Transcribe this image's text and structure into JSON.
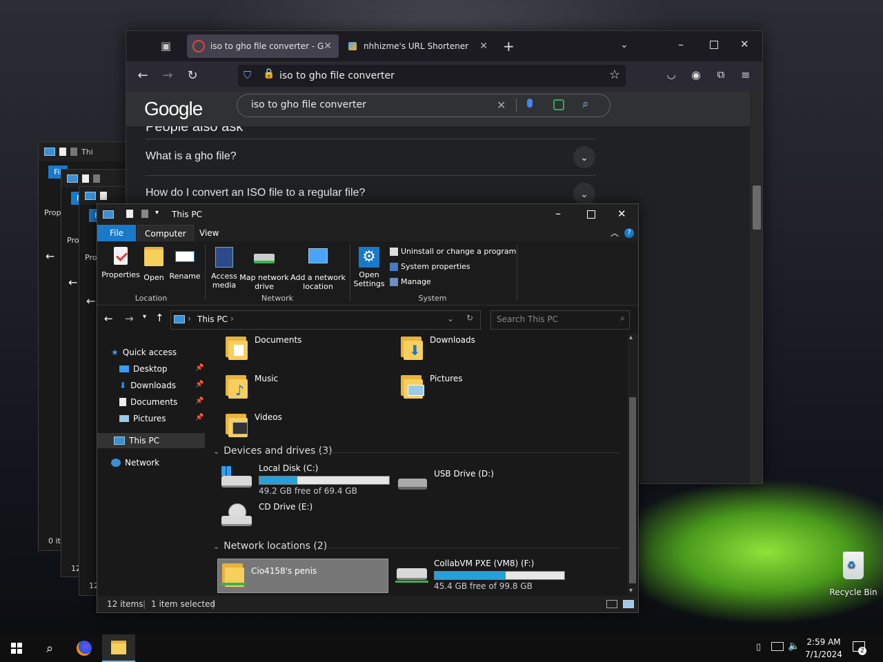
{
  "browser": {
    "tabs": [
      {
        "title": "iso to gho file converter - Goog",
        "active": true
      },
      {
        "title": "nhhizme's URL Shortener",
        "active": false
      }
    ],
    "url": "iso to gho file converter",
    "google_logo": "Google",
    "search_query": "iso to gho file converter",
    "paa_heading_partial": "People also ask",
    "paa_items": [
      "What is a gho file?",
      "How do I convert an ISO file to a regular file?"
    ]
  },
  "ghost_windows": {
    "title_partial": "Thi",
    "file_partial": "Fil",
    "props_partial_1": "Prop",
    "props_partial_2": "Pro",
    "status_partial_1": "0 it",
    "status_partial_2": "12",
    "status_partial_3": "12"
  },
  "explorer": {
    "title": "This PC",
    "tabs": [
      "File",
      "Computer",
      "View"
    ],
    "ribbon": {
      "location": {
        "group": "Location",
        "buttons": [
          "Properties",
          "Open",
          "Rename"
        ]
      },
      "network": {
        "group": "Network",
        "buttons": [
          "Access media",
          "Map network drive",
          "Add a network location"
        ]
      },
      "system": {
        "group": "System",
        "open_settings": "Open Settings",
        "items": [
          "Uninstall or change a program",
          "System properties",
          "Manage"
        ]
      }
    },
    "breadcrumb": "This PC",
    "search_placeholder": "Search This PC",
    "nav": {
      "quick_access": "Quick access",
      "pinned": [
        "Desktop",
        "Downloads",
        "Documents",
        "Pictures"
      ],
      "this_pc": "This PC",
      "network": "Network"
    },
    "folders": [
      "Documents",
      "Downloads",
      "Music",
      "Pictures",
      "Videos"
    ],
    "devices_header": "Devices and drives (3)",
    "drives": [
      {
        "name": "Local Disk (C:)",
        "free": "49.2 GB free of 69.4 GB",
        "used_fraction": 0.29
      },
      {
        "name": "USB Drive (D:)"
      },
      {
        "name": "CD Drive (E:)"
      }
    ],
    "network_header": "Network locations (2)",
    "network_locations": [
      {
        "name": "Cio4158's penis",
        "selected": true
      },
      {
        "name": "CollabVM PXE (VM8) (F:)",
        "free": "45.4 GB free of 99.8 GB",
        "used_fraction": 0.55
      }
    ],
    "status": {
      "items": "12 items",
      "selected": "1 item selected"
    }
  },
  "desktop": {
    "recycle_bin": "Recycle Bin"
  },
  "taskbar": {
    "time": "2:59 AM",
    "date": "7/1/2024",
    "notification_count": "2"
  },
  "colors": {
    "accent": "#1979ca",
    "progress": "#26a0da",
    "selection": "#777777"
  }
}
